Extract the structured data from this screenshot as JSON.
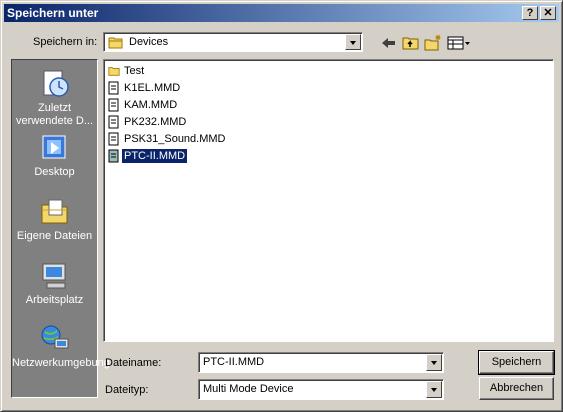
{
  "window": {
    "title": "Speichern unter",
    "help_glyph": "?",
    "close_glyph": "✕"
  },
  "lookin": {
    "label": "Speichern in:",
    "value": "Devices",
    "folder_icon": "folder-icon"
  },
  "toolbar": {
    "back_icon": "back-arrow-icon",
    "up_icon": "up-folder-icon",
    "newfolder_icon": "new-folder-icon",
    "views_icon": "views-menu-icon"
  },
  "places": [
    {
      "label": "Zuletzt verwendete D...",
      "icon": "recent-documents-icon"
    },
    {
      "label": "Desktop",
      "icon": "desktop-icon"
    },
    {
      "label": "Eigene Dateien",
      "icon": "my-documents-icon"
    },
    {
      "label": "Arbeitsplatz",
      "icon": "my-computer-icon"
    },
    {
      "label": "Netzwerkumgebung",
      "icon": "network-icon"
    }
  ],
  "files": [
    {
      "name": "Test",
      "type": "folder"
    },
    {
      "name": "K1EL.MMD",
      "type": "file"
    },
    {
      "name": "KAM.MMD",
      "type": "file"
    },
    {
      "name": "PK232.MMD",
      "type": "file"
    },
    {
      "name": "PSK31_Sound.MMD",
      "type": "file"
    },
    {
      "name": "PTC-II.MMD",
      "type": "file",
      "selected": true
    }
  ],
  "filename": {
    "label": "Dateiname:",
    "value": "PTC-II.MMD"
  },
  "filetype": {
    "label": "Dateityp:",
    "value": "Multi Mode Device"
  },
  "buttons": {
    "save": "Speichern",
    "cancel": "Abbrechen"
  },
  "colors": {
    "title_start": "#0a246a",
    "title_end": "#a6caf0",
    "face": "#d4d0c8",
    "selection": "#0a246a"
  }
}
